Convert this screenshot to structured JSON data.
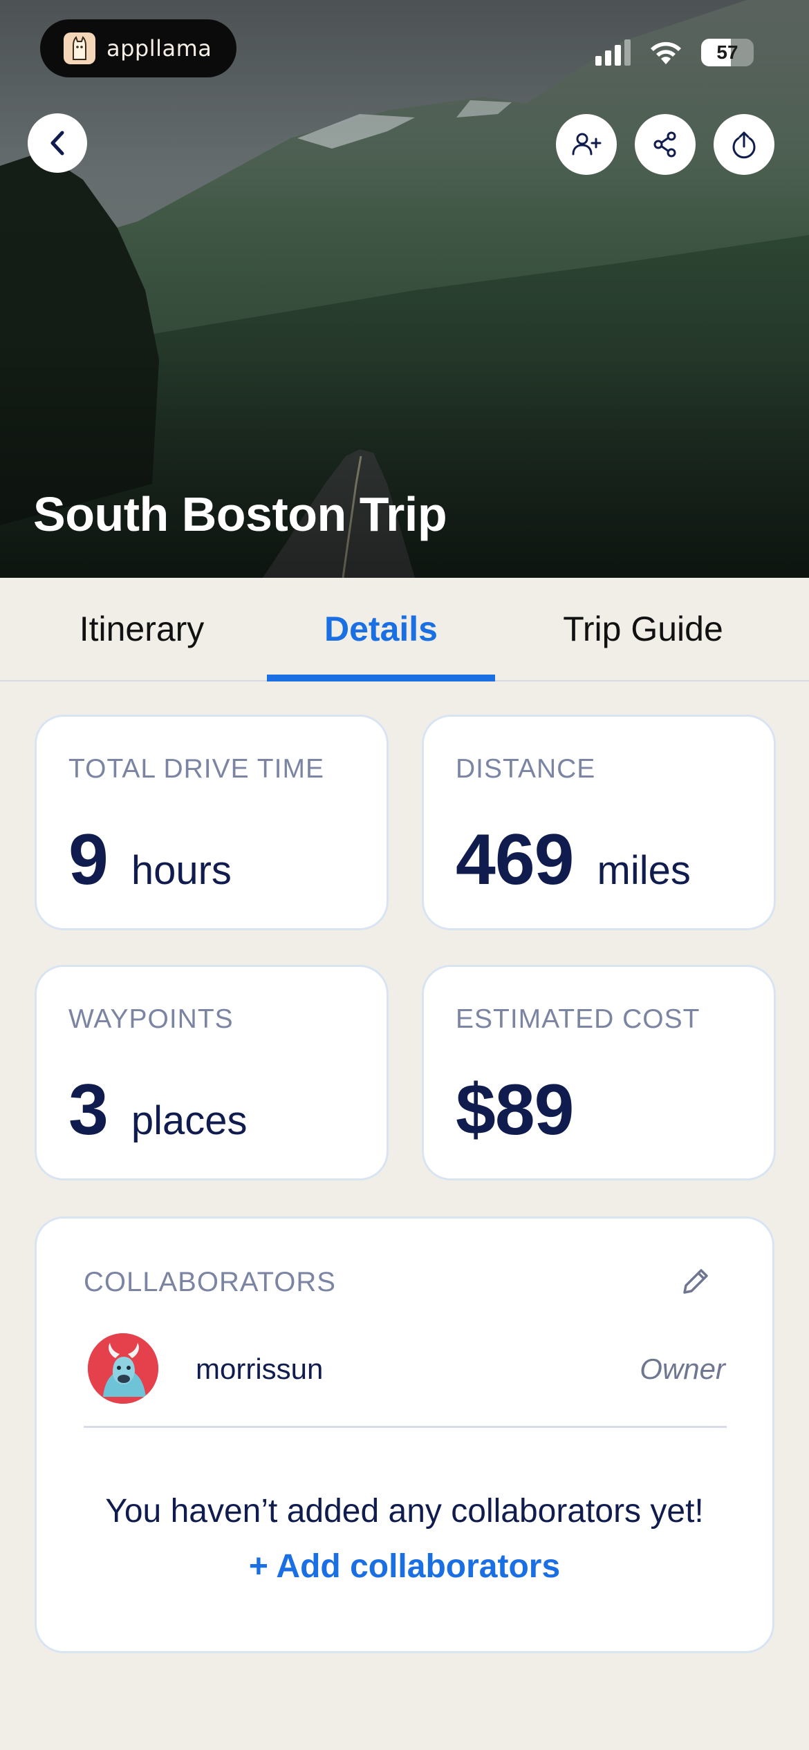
{
  "brand": {
    "name": "appllama",
    "logo_icon": "llama-icon"
  },
  "status_bar": {
    "battery": "57",
    "battery_level": 0.57,
    "icons": [
      "signal-icon",
      "wifi-icon",
      "battery-icon"
    ]
  },
  "header": {
    "title": "South Boston Trip",
    "buttons": [
      "back-icon",
      "add-person-icon",
      "share-icon",
      "export-icon"
    ]
  },
  "tabs": [
    {
      "label": "Itinerary",
      "active": false
    },
    {
      "label": "Details",
      "active": true
    },
    {
      "label": "Trip Guide",
      "active": false
    }
  ],
  "stats": {
    "drive_time": {
      "label": "TOTAL DRIVE TIME",
      "value": "9",
      "unit": "hours"
    },
    "distance": {
      "label": "DISTANCE",
      "value": "469",
      "unit": "miles"
    },
    "waypoints": {
      "label": "WAYPOINTS",
      "value": "3",
      "unit": "places"
    },
    "cost": {
      "label": "ESTIMATED COST",
      "value": "$89",
      "unit": ""
    }
  },
  "collaborators": {
    "label": "COLLABORATORS",
    "members": [
      {
        "username": "morrissun",
        "role": "Owner"
      }
    ],
    "empty_text": "You haven’t added any collaborators yet!",
    "add_label": "+ Add collaborators"
  },
  "colors": {
    "accent": "#1a6fe3",
    "text_dark": "#0f1c4d",
    "label_gray": "#7b85a3",
    "background": "#f1eee8",
    "card_border": "#d9e4f3"
  }
}
